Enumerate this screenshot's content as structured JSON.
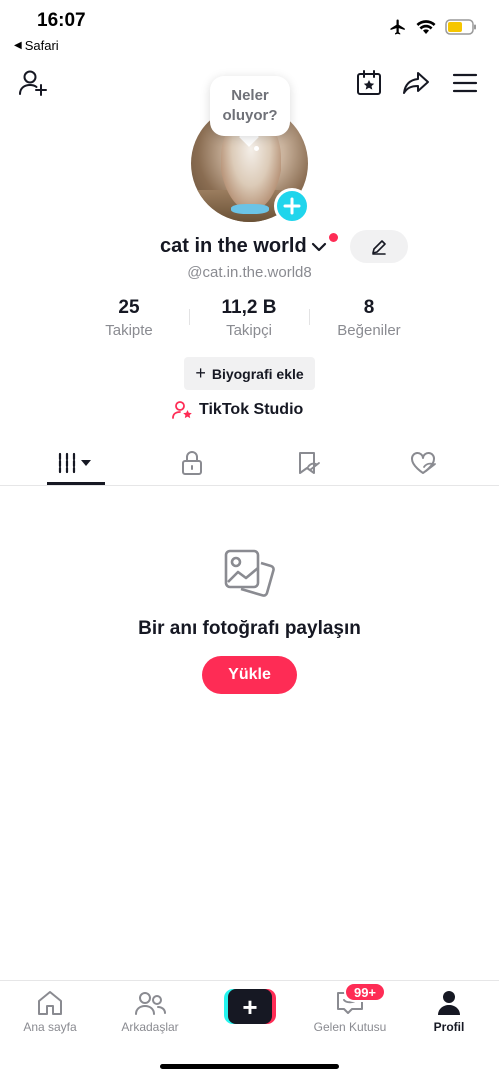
{
  "status_bar": {
    "time": "16:07",
    "back_app": "Safari",
    "icons": [
      "airplane-mode-icon",
      "wifi-icon",
      "battery-icon"
    ],
    "battery_color": "#f6c600"
  },
  "top_bar": {
    "left_icon": "add-user-icon",
    "right_icons": [
      "calendar-star-icon",
      "share-icon",
      "menu-icon"
    ]
  },
  "profile": {
    "bubble_text": "Neler oluyor?",
    "username": "cat in the world",
    "handle": "@cat.in.the.world8",
    "stats": [
      {
        "value": "25",
        "label": "Takipte"
      },
      {
        "value": "11,2 B",
        "label": "Takipçi"
      },
      {
        "value": "8",
        "label": "Beğeniler"
      }
    ],
    "bio_button": "Biyografi ekle",
    "studio_link": "TikTok Studio"
  },
  "tabs": [
    "videos-grid-icon",
    "lock-icon",
    "bookmark-icon",
    "liked-heart-icon"
  ],
  "empty_state": {
    "title": "Bir anı fotoğrafı paylaşın",
    "button": "Yükle"
  },
  "bottom_nav": {
    "items": [
      {
        "label": "Ana sayfa",
        "icon": "home-icon"
      },
      {
        "label": "Arkadaşlar",
        "icon": "friends-icon"
      },
      {
        "label": "",
        "icon": "create-icon"
      },
      {
        "label": "Gelen Kutusu",
        "icon": "inbox-icon",
        "badge": "99+"
      },
      {
        "label": "Profil",
        "icon": "profile-icon"
      }
    ]
  },
  "colors": {
    "accent": "#fe2c55",
    "cyan": "#25f4ee",
    "avatar_add": "#20d5ec",
    "text": "#161823",
    "muted": "#8a8b91"
  }
}
